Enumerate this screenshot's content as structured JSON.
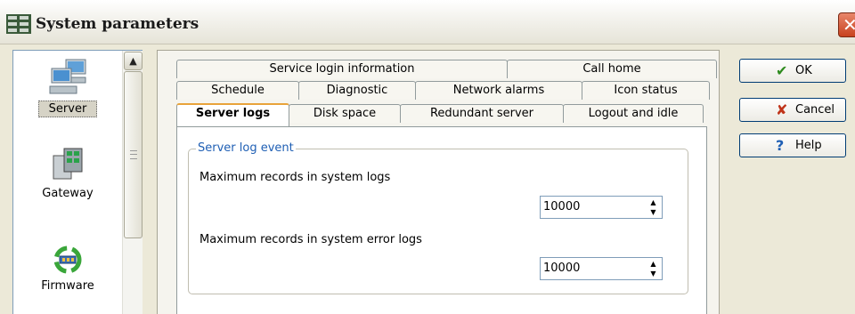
{
  "window": {
    "title": "System parameters",
    "close_glyph": "✕"
  },
  "nav": {
    "items": [
      {
        "label": "Server",
        "icon": "server-icon",
        "selected": true
      },
      {
        "label": "Gateway",
        "icon": "gateway-icon",
        "selected": false
      },
      {
        "label": "Firmware",
        "icon": "firmware-icon",
        "selected": false
      }
    ],
    "scroll_up_glyph": "▲"
  },
  "tabs": {
    "row1": [
      "Service login information",
      "Call home"
    ],
    "row2": [
      "Schedule",
      "Diagnostic",
      "Network alarms",
      "Icon status"
    ],
    "row3": [
      "Server logs",
      "Disk space",
      "Redundant server",
      "Logout and idle"
    ],
    "active": "Server logs"
  },
  "server_logs": {
    "group_title": "Server log event",
    "max_records_label": "Maximum records in system logs",
    "max_records_value": "10000",
    "max_error_records_label": "Maximum records in system error logs",
    "max_error_records_value": "10000",
    "spin_up_glyph": "▲",
    "spin_down_glyph": "▼"
  },
  "buttons": {
    "ok": {
      "label": "OK",
      "icon": "checkmark-icon",
      "glyph": "✔",
      "color": "#2e8b1e"
    },
    "cancel": {
      "label": "Cancel",
      "icon": "x-icon",
      "glyph": "✘",
      "color": "#c0341a"
    },
    "help": {
      "label": "Help",
      "icon": "question-icon",
      "glyph": "?",
      "color": "#1f5fb4"
    }
  }
}
